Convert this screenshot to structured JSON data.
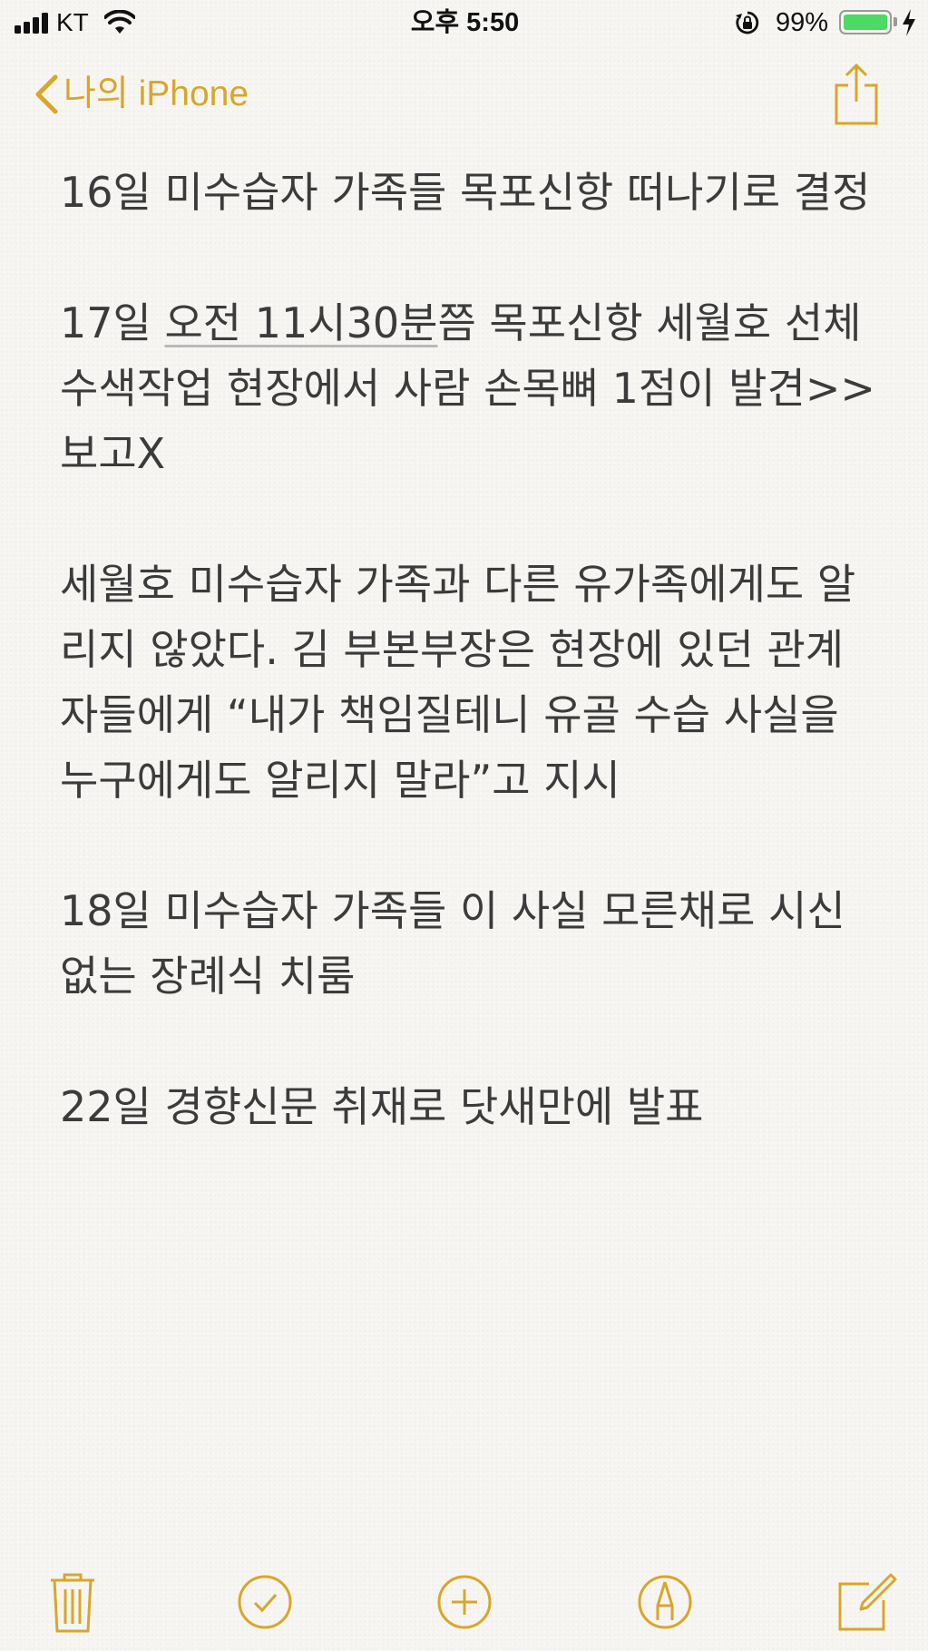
{
  "status_bar": {
    "carrier": "KT",
    "time": "오후 5:50",
    "battery_percent": "99%",
    "battery_level": 0.99,
    "icons": [
      "cellular-signal-icon",
      "wifi-icon",
      "rotation-lock-icon",
      "battery-icon",
      "charging-bolt-icon"
    ]
  },
  "nav": {
    "back_label": "나의 iPhone",
    "back_icon": "chevron-left-icon",
    "share_icon": "share-icon"
  },
  "note": {
    "paragraphs": [
      {
        "text": "16일 미수습자 가족들 목포신항 떠나기로 결정"
      },
      {
        "before": "17일 ",
        "date_link": "오전 11시30분",
        "after": "쯤 목포신항 세월호 선체 수색작업 현장에서 사람 손목뼈 1점이 발견>>보고X"
      },
      {
        "text": "세월호 미수습자 가족과 다른 유가족에게도 알리지 않았다. 김 부본부장은 현장에 있던 관계자들에게 “내가 책임질테니 유골 수습 사실을 누구에게도 알리지 말라”고 지시"
      },
      {
        "text": "18일 미수습자 가족들 이 사실 모른채로 시신 없는 장례식 치룸"
      },
      {
        "text": "22일 경향신문 취재로 닷새만에 발표"
      }
    ]
  },
  "toolbar": {
    "buttons": [
      "trash-icon",
      "checklist-icon",
      "add-icon",
      "markup-pen-icon",
      "compose-icon"
    ]
  },
  "colors": {
    "accent": "#d9a62a",
    "text": "#3b3b3b",
    "paper": "#f6f5f2",
    "battery_fill": "#4cd964"
  }
}
